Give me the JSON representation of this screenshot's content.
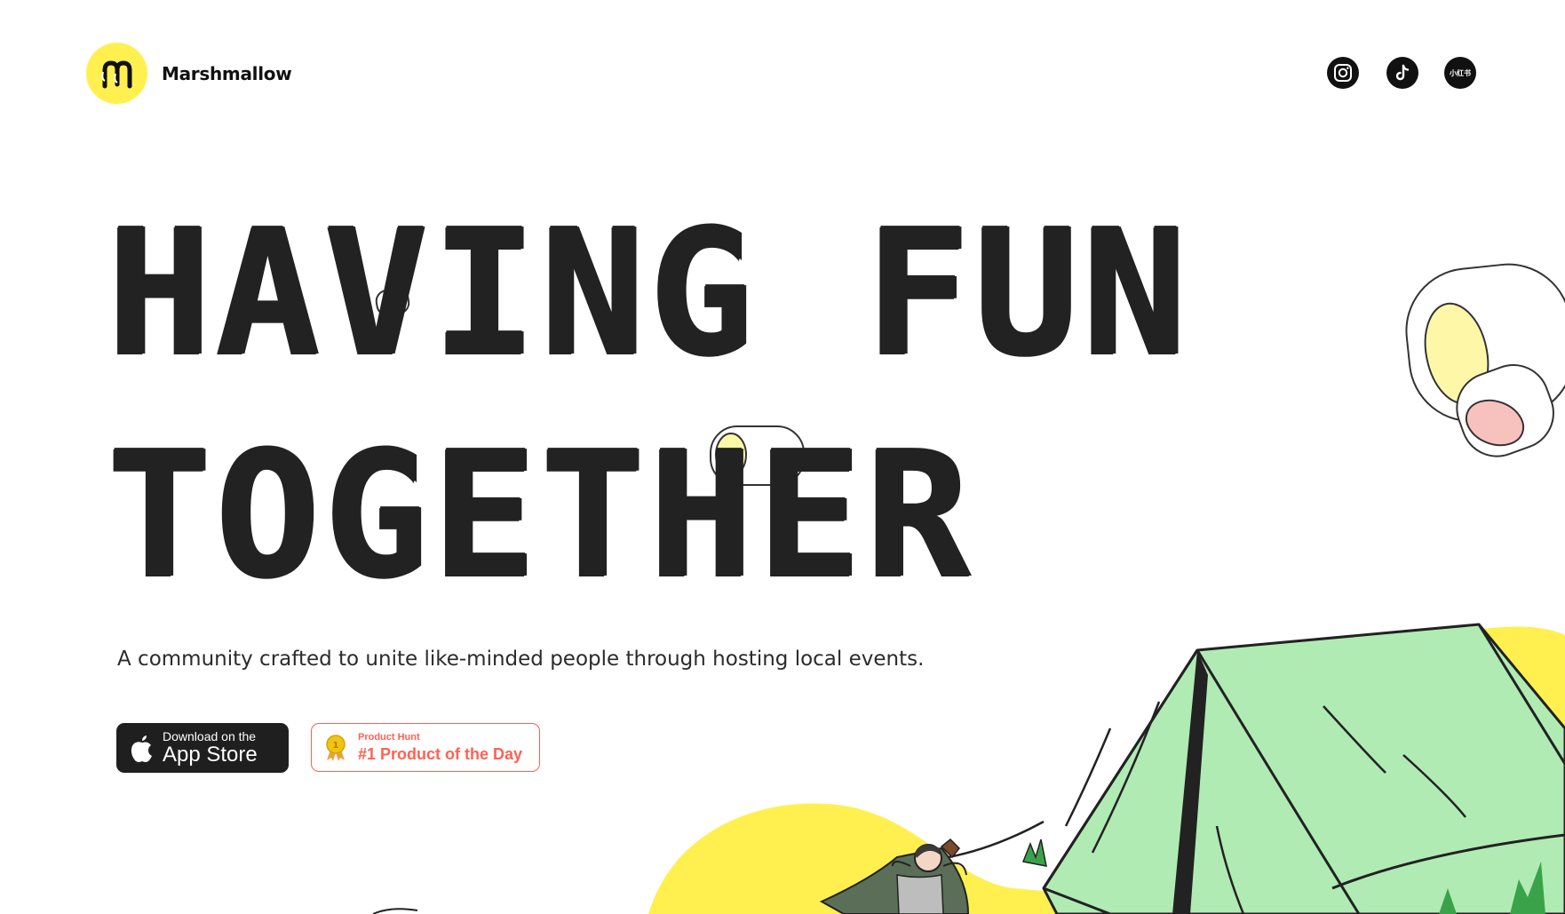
{
  "brand": {
    "name": "Marshmallow",
    "logo_icon": "marshmallow-logo-icon"
  },
  "social": [
    {
      "name": "instagram",
      "icon": "instagram-icon"
    },
    {
      "name": "tiktok",
      "icon": "tiktok-icon"
    },
    {
      "name": "xiaohongshu",
      "label": "小红书",
      "icon": "xiaohongshu-icon"
    }
  ],
  "hero": {
    "headline_line1": "HAVING FUN",
    "headline_line2": "TOGETHER",
    "subtitle": "A community crafted to unite like-minded people through hosting local events."
  },
  "cta": {
    "appstore_small": "Download on the",
    "appstore_big": "App Store",
    "ph_small": "Product Hunt",
    "ph_big": "#1 Product of the Day"
  },
  "colors": {
    "accent_yellow": "#fff04f",
    "tent_green": "#b0ebb4",
    "ph_red": "#ff6154",
    "ink": "#222222"
  }
}
